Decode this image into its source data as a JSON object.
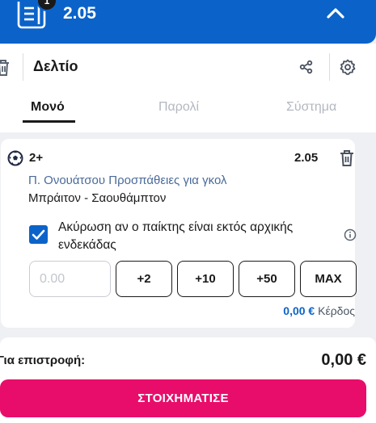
{
  "header": {
    "badge_count": "1",
    "total_odds": "2.05",
    "colors": {
      "bar": "#0b63c9"
    }
  },
  "panel": {
    "title": "Δελτίο",
    "tabs": [
      {
        "label": "Μονό",
        "active": true
      },
      {
        "label": "Παρολί",
        "active": false
      },
      {
        "label": "Σύστημα",
        "active": false
      }
    ]
  },
  "bet": {
    "selection": "2+",
    "odds": "2.05",
    "market": "Π. Ονουάτσου Προσπάθειες για γκολ",
    "match": "Μπράιτον - Σαουθάμπτον",
    "cancel_checked": true,
    "cancel_label": "Ακύρωση αν ο παίκτης είναι εκτός αρχικής ενδεκάδας",
    "stake_placeholder": "0.00",
    "stake_value": "",
    "quick_stakes": [
      "+2",
      "+10",
      "+50",
      "MAX"
    ],
    "win_amount": "0,00 €",
    "win_label": "Κέρδος"
  },
  "footer": {
    "return_label": "Για επιστροφή:",
    "return_value": "0,00 €",
    "place_bet_label": "ΣΤΟΙΧΗΜΑΤΙΣΕ",
    "colors": {
      "place_bet": "#e80d6b"
    }
  }
}
